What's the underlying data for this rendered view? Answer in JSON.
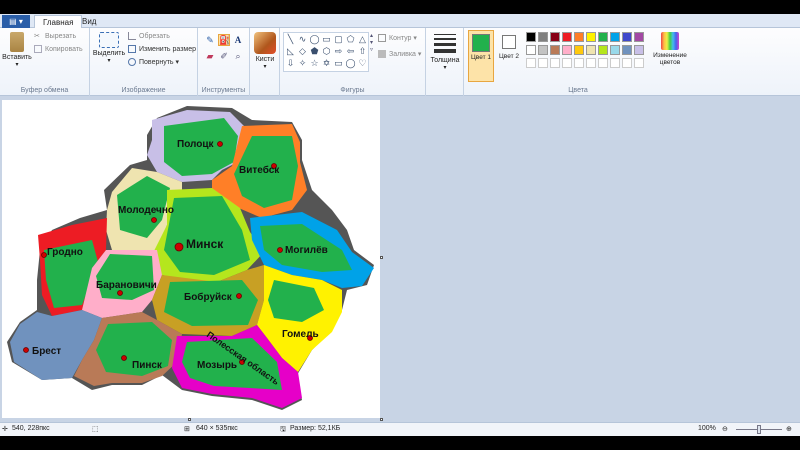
{
  "tabs": {
    "file": "▤ ▾",
    "home": "Главная",
    "view": "Вид"
  },
  "clipboard": {
    "paste": "Вставить",
    "cut": "Вырезать",
    "copy": "Копировать",
    "label": "Буфер обмена"
  },
  "image": {
    "select": "Выделить",
    "crop": "Обрезать",
    "resize": "Изменить размер",
    "rotate": "Повернуть ▾",
    "label": "Изображение"
  },
  "tools": {
    "label": "Инструменты"
  },
  "brushes": {
    "label": "Кисти"
  },
  "shapes": {
    "outline": "Контур ▾",
    "fill": "Заливка ▾",
    "label": "Фигуры"
  },
  "size": {
    "label": "Толщина"
  },
  "colors": {
    "color1": "Цвет 1",
    "color2": "Цвет 2",
    "edit": "Изменение цветов",
    "label": "Цвета",
    "color1_value": "#22b14c",
    "color2_value": "#ffffff",
    "palette_row1": [
      "#000000",
      "#7f7f7f",
      "#880015",
      "#ed1c24",
      "#ff7f27",
      "#fff200",
      "#22b14c",
      "#00a2e8",
      "#3f48cc",
      "#a349a4"
    ],
    "palette_row2": [
      "#ffffff",
      "#c3c3c3",
      "#b97a57",
      "#ffaec9",
      "#ffc90e",
      "#efe4b0",
      "#b5e61d",
      "#99d9ea",
      "#7092be",
      "#c8bfe7"
    ]
  },
  "map": {
    "cities": {
      "polotsk": "Полоцк",
      "vitebsk": "Витебск",
      "molodechno": "Молодечно",
      "minsk": "Минск",
      "mogilev": "Могилёв",
      "grodno": "Гродно",
      "baranovichi": "Барановичи",
      "bobruisk": "Бобруйск",
      "gomel": "Гомель",
      "brest": "Брест",
      "pinsk": "Пинск",
      "mozyr": "Мозырь"
    },
    "region_label": "Полесская область"
  },
  "status": {
    "cursor": "540, 228пкс",
    "dimensions": "640 × 535пкс",
    "filesize": "Размер: 52,1КБ",
    "zoom": "100%"
  }
}
